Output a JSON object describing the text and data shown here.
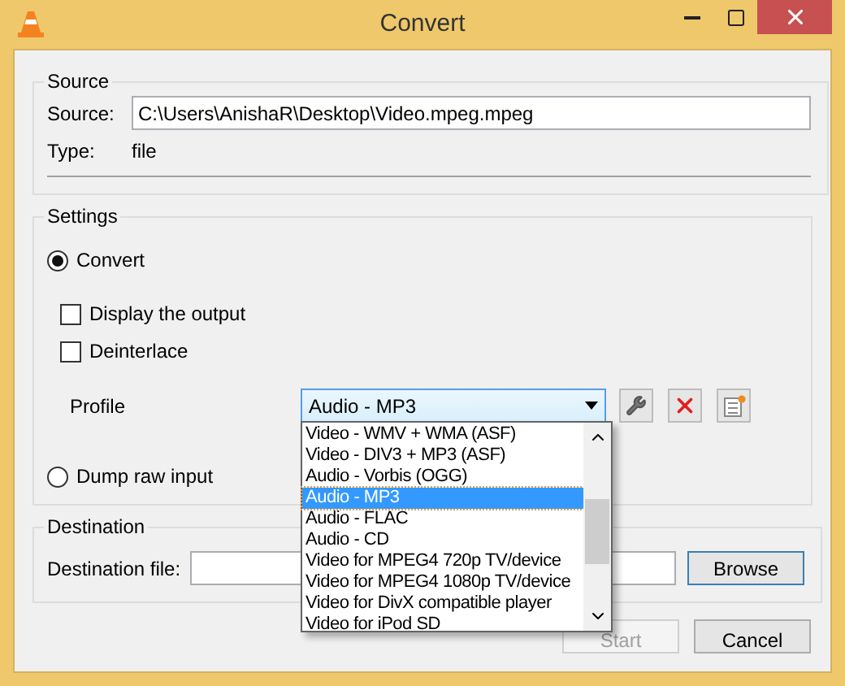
{
  "window": {
    "title": "Convert"
  },
  "source": {
    "title": "Source",
    "label": "Source:",
    "value": "C:\\Users\\AnishaR\\Desktop\\Video.mpeg.mpeg",
    "type_label": "Type:",
    "type_value": "file"
  },
  "settings": {
    "title": "Settings",
    "convert": {
      "label": "Convert",
      "selected": true
    },
    "checkboxes": [
      {
        "label": "Display the output",
        "checked": false
      },
      {
        "label": "Deinterlace",
        "checked": false
      }
    ],
    "profile": {
      "label": "Profile",
      "value": "Audio - MP3",
      "expanded": true,
      "options": [
        {
          "label": "Video - WMV + WMA (ASF)",
          "selected": false
        },
        {
          "label": "Video - DIV3 + MP3 (ASF)",
          "selected": false
        },
        {
          "label": "Audio - Vorbis (OGG)",
          "selected": false
        },
        {
          "label": "Audio - MP3",
          "selected": true
        },
        {
          "label": "Audio - FLAC",
          "selected": false
        },
        {
          "label": "Audio - CD",
          "selected": false
        },
        {
          "label": "Video for MPEG4 720p TV/device",
          "selected": false
        },
        {
          "label": "Video for MPEG4 1080p TV/device",
          "selected": false
        },
        {
          "label": "Video for DivX compatible player",
          "selected": false
        },
        {
          "label": "Video for iPod SD",
          "selected": false
        }
      ]
    },
    "dump": {
      "label": "Dump raw input",
      "selected": false
    }
  },
  "destination": {
    "title": "Destination",
    "label": "Destination file:",
    "button": "Browse"
  },
  "buttons": [
    {
      "label": "Start",
      "disabled": true
    },
    {
      "label": "Cancel",
      "disabled": false
    }
  ]
}
